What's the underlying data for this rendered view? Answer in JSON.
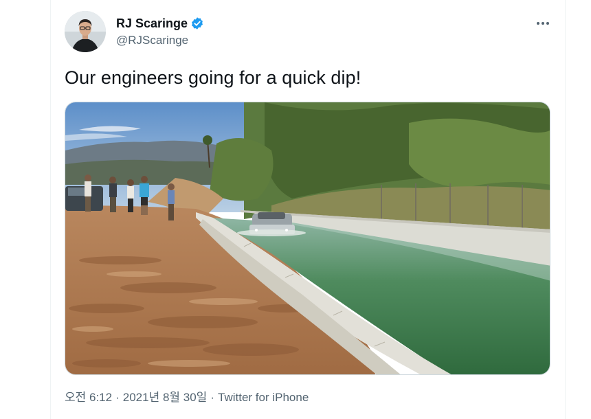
{
  "author": {
    "name": "RJ Scaringe",
    "handle": "@RJScaringe",
    "verified": true,
    "verified_icon": "verified-badge-icon",
    "avatar_icon": "profile-avatar"
  },
  "tweet": {
    "text": "Our engineers going for a quick dip!",
    "media": "photo-truck-in-water-channel"
  },
  "meta": {
    "time": "오전 6:12",
    "separator": "·",
    "date": "2021년 8월 30일",
    "source": "Twitter for iPhone"
  },
  "menu": {
    "icon": "more-horizontal-icon"
  },
  "colors": {
    "text_primary": "#0f1419",
    "text_secondary": "#536471",
    "verified_blue": "#1d9bf0",
    "border": "#eff3f4"
  }
}
